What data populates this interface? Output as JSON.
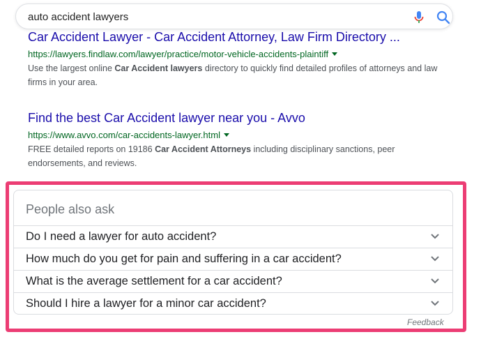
{
  "search": {
    "query": "auto accident lawyers",
    "icons": {
      "voice": "mic-icon",
      "submit": "search-icon"
    },
    "colors": {
      "mic_blue": "#4285f4",
      "mic_red": "#ea4335",
      "search_blue": "#4285f4"
    }
  },
  "results": [
    {
      "title": "Car Accident Lawyer - Car Accident Attorney, Law Firm Directory ...",
      "url": "https://lawyers.findlaw.com/lawyer/practice/motor-vehicle-accidents-plaintiff",
      "snippet_parts": [
        {
          "text": "Use the largest online ",
          "bold": false
        },
        {
          "text": "Car Accident lawyers",
          "bold": true
        },
        {
          "text": " directory to quickly find detailed profiles of attorneys and law firms in your area.",
          "bold": false
        }
      ]
    },
    {
      "title": "Find the best Car Accident lawyer near you - Avvo",
      "url": "https://www.avvo.com/car-accidents-lawyer.html",
      "snippet_parts": [
        {
          "text": "FREE detailed reports on 19186 ",
          "bold": false
        },
        {
          "text": "Car Accident Attorneys",
          "bold": true
        },
        {
          "text": " including disciplinary sanctions, peer endorsements, and reviews.",
          "bold": false
        }
      ]
    }
  ],
  "people_also_ask": {
    "title": "People also ask",
    "questions": [
      "Do I need a lawyer for auto accident?",
      "How much do you get for pain and suffering in a car accident?",
      "What is the average settlement for a car accident?",
      "Should I hire a lawyer for a minor car accident?"
    ],
    "feedback": "Feedback",
    "highlight_color": "#ec3d74"
  }
}
